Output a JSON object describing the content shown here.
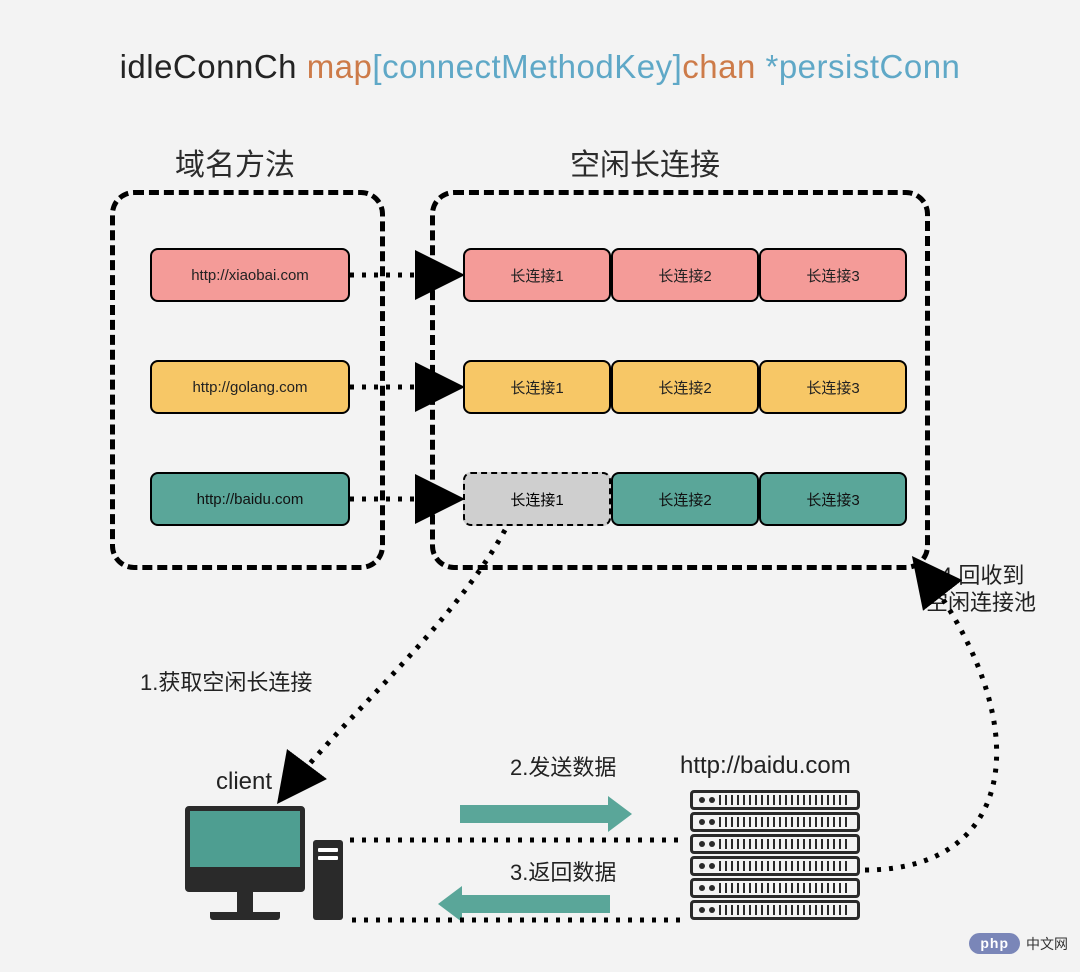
{
  "title": {
    "p1": "idleConnCh ",
    "p2": "map",
    "p3": "[",
    "p4": "connectMethodKey",
    "p5": "]",
    "p6": "chan ",
    "p7": "*",
    "p8": "persistConn"
  },
  "sections": {
    "keys_title": "域名方法",
    "conns_title": "空闲长连接"
  },
  "keys": [
    "http://xiaobai.com",
    "http://golang.com",
    "http://baidu.com"
  ],
  "conn_labels": [
    "长连接1",
    "长连接2",
    "长连接3"
  ],
  "steps": {
    "s1": "1.获取空闲长连接",
    "s2": "2.发送数据",
    "s3": "3.返回数据",
    "s4a": "4.回收到",
    "s4b": "空闲连接池"
  },
  "client_label": "client",
  "server_label": "http://baidu.com",
  "watermark": {
    "badge": "php",
    "text": "中文网"
  },
  "colors": {
    "pink": "#f49b98",
    "gold": "#f7c766",
    "teal": "#5aa699",
    "gray": "#cfcfcf"
  }
}
